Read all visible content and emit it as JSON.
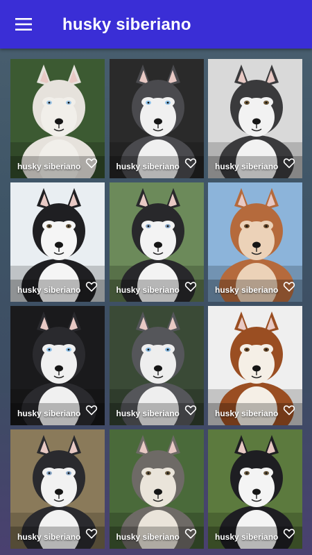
{
  "header": {
    "title": "husky siberiano",
    "menu_icon": "hamburger-menu-icon",
    "background": "#3a2ed6"
  },
  "tiles": [
    {
      "label": "husky siberiano",
      "bg": "#3c5a32",
      "fur": "#f1efea",
      "mask": "#e6e2dc",
      "eye": "#9fc6e6",
      "fav_icon": "heart-outline-icon"
    },
    {
      "label": "husky siberiano",
      "bg": "#2a2a2a",
      "fur": "#f0f0f0",
      "mask": "#4a4a4e",
      "eye": "#8fc2ea",
      "fav_icon": "heart-outline-icon"
    },
    {
      "label": "husky siberiano",
      "bg": "#d9d9d9",
      "fur": "#f2f2f2",
      "mask": "#3a3a3c",
      "eye": "#6f5a3a",
      "fav_icon": "heart-outline-icon"
    },
    {
      "label": "husky siberiano",
      "bg": "#e9eef2",
      "fur": "#f5f5f5",
      "mask": "#1f1f22",
      "eye": "#6a5a40",
      "fav_icon": "heart-outline-icon"
    },
    {
      "label": "husky siberiano",
      "bg": "#6c8a5a",
      "fur": "#f3f3f3",
      "mask": "#28282b",
      "eye": "#8aa8c8",
      "fav_icon": "heart-outline-icon"
    },
    {
      "label": "husky siberiano",
      "bg": "#8cb4da",
      "fur": "#ecd2b8",
      "mask": "#b56a3c",
      "eye": "#6a4a2a",
      "fav_icon": "heart-outline-icon"
    },
    {
      "label": "husky siberiano",
      "bg": "#1a1a1c",
      "fur": "#f0f0f0",
      "mask": "#2a2a2e",
      "eye": "#8fc2ea",
      "fav_icon": "heart-outline-icon"
    },
    {
      "label": "husky siberiano",
      "bg": "#3a4a36",
      "fur": "#eeeeee",
      "mask": "#55565a",
      "eye": "#86b8e0",
      "fav_icon": "heart-outline-icon"
    },
    {
      "label": "husky siberiano",
      "bg": "#efefef",
      "fur": "#f5efe6",
      "mask": "#9a4e22",
      "eye": "#6a4a2a",
      "fav_icon": "heart-outline-icon"
    },
    {
      "label": "husky siberiano",
      "bg": "#8a7a5a",
      "fur": "#f2f2f2",
      "mask": "#2a2a2e",
      "eye": "#8aa8c8",
      "fav_icon": "heart-outline-icon"
    },
    {
      "label": "husky siberiano",
      "bg": "#4a6a3a",
      "fur": "#eae4da",
      "mask": "#6e6a66",
      "eye": "#6a5a40",
      "fav_icon": "heart-outline-icon"
    },
    {
      "label": "husky siberiano",
      "bg": "#5c7a3e",
      "fur": "#f4f4f4",
      "mask": "#1e1e22",
      "eye": "#6a5a40",
      "fav_icon": "heart-outline-icon"
    }
  ]
}
